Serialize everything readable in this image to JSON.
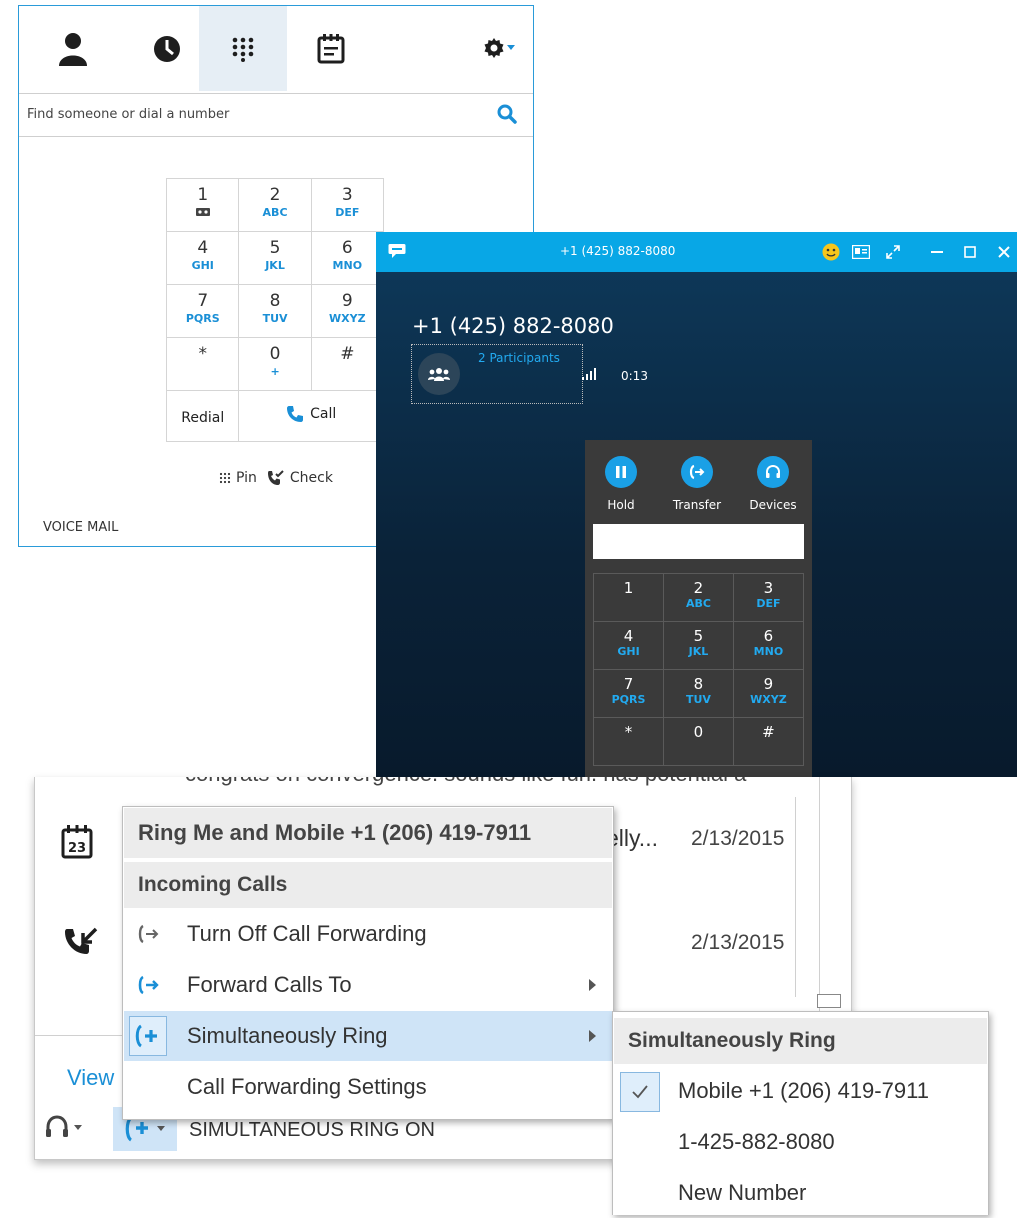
{
  "dialer": {
    "tabs": [
      {
        "name": "contacts",
        "icon": "person-icon"
      },
      {
        "name": "recent",
        "icon": "clock-icon"
      },
      {
        "name": "dial-pad",
        "icon": "dialpad-icon",
        "active": true
      },
      {
        "name": "meetings",
        "icon": "notepad-icon"
      }
    ],
    "settings_icon": "gear-icon",
    "search_placeholder": "Find someone or dial a number",
    "keypad": [
      {
        "digit": "1",
        "letters": "",
        "icon": "voicemail-icon"
      },
      {
        "digit": "2",
        "letters": "ABC"
      },
      {
        "digit": "3",
        "letters": "DEF"
      },
      {
        "digit": "4",
        "letters": "GHI"
      },
      {
        "digit": "5",
        "letters": "JKL"
      },
      {
        "digit": "6",
        "letters": "MNO"
      },
      {
        "digit": "7",
        "letters": "PQRS"
      },
      {
        "digit": "8",
        "letters": "TUV"
      },
      {
        "digit": "9",
        "letters": "WXYZ"
      },
      {
        "digit": "*",
        "letters": ""
      },
      {
        "digit": "0",
        "letters": "+"
      },
      {
        "digit": "#",
        "letters": ""
      }
    ],
    "redial_label": "Redial",
    "call_label": "Call",
    "pin_label": "Pin",
    "check_label": "Check",
    "voicemail_label": "VOICE MAIL"
  },
  "call_window": {
    "title": "+1 (425) 882-8080",
    "number": "+1 (425) 882-8080",
    "participants_label": "2 Participants",
    "duration": "0:13",
    "buttons": [
      {
        "label": "Hold",
        "icon": "pause-icon"
      },
      {
        "label": "Transfer",
        "icon": "transfer-icon"
      },
      {
        "label": "Devices",
        "icon": "headset-icon"
      }
    ],
    "keypad": [
      {
        "digit": "1",
        "letters": ""
      },
      {
        "digit": "2",
        "letters": "ABC"
      },
      {
        "digit": "3",
        "letters": "DEF"
      },
      {
        "digit": "4",
        "letters": "GHI"
      },
      {
        "digit": "5",
        "letters": "JKL"
      },
      {
        "digit": "6",
        "letters": "MNO"
      },
      {
        "digit": "7",
        "letters": "PQRS"
      },
      {
        "digit": "8",
        "letters": "TUV"
      },
      {
        "digit": "9",
        "letters": "WXYZ"
      },
      {
        "digit": "*",
        "letters": ""
      },
      {
        "digit": "0",
        "letters": ""
      },
      {
        "digit": "#",
        "letters": ""
      }
    ]
  },
  "main_window": {
    "cut_text": "congrats on convergence. sounds like fun. has potential a",
    "rows": [
      {
        "text": "elly...",
        "date": "2/13/2015",
        "icon": "calendar-icon"
      },
      {
        "text": "",
        "date": "2/13/2015",
        "icon": "missed-call-icon"
      }
    ],
    "view_link": "View",
    "status_text": "SIMULTANEOUS RING ON"
  },
  "menu": {
    "header": "Ring Me and Mobile +1 (206) 419-7911",
    "section": "Incoming Calls",
    "items": [
      {
        "label": "Turn Off Call Forwarding",
        "icon": "forward-off-icon"
      },
      {
        "label": "Forward Calls To",
        "icon": "forward-icon",
        "submenu": true
      },
      {
        "label": "Simultaneously Ring",
        "icon": "simul-ring-icon",
        "submenu": true,
        "selected": true
      },
      {
        "label": "Call Forwarding Settings",
        "icon": ""
      }
    ]
  },
  "submenu": {
    "header": "Simultaneously Ring",
    "items": [
      {
        "label": "Mobile +1 (206) 419-7911",
        "checked": true
      },
      {
        "label": "1-425-882-8080",
        "checked": false
      },
      {
        "label": "New Number",
        "checked": false
      }
    ]
  },
  "colors": {
    "accent": "#1a8fd6",
    "call_titlebar": "#08a7e6",
    "menu_highlight": "#cfe4f7"
  }
}
